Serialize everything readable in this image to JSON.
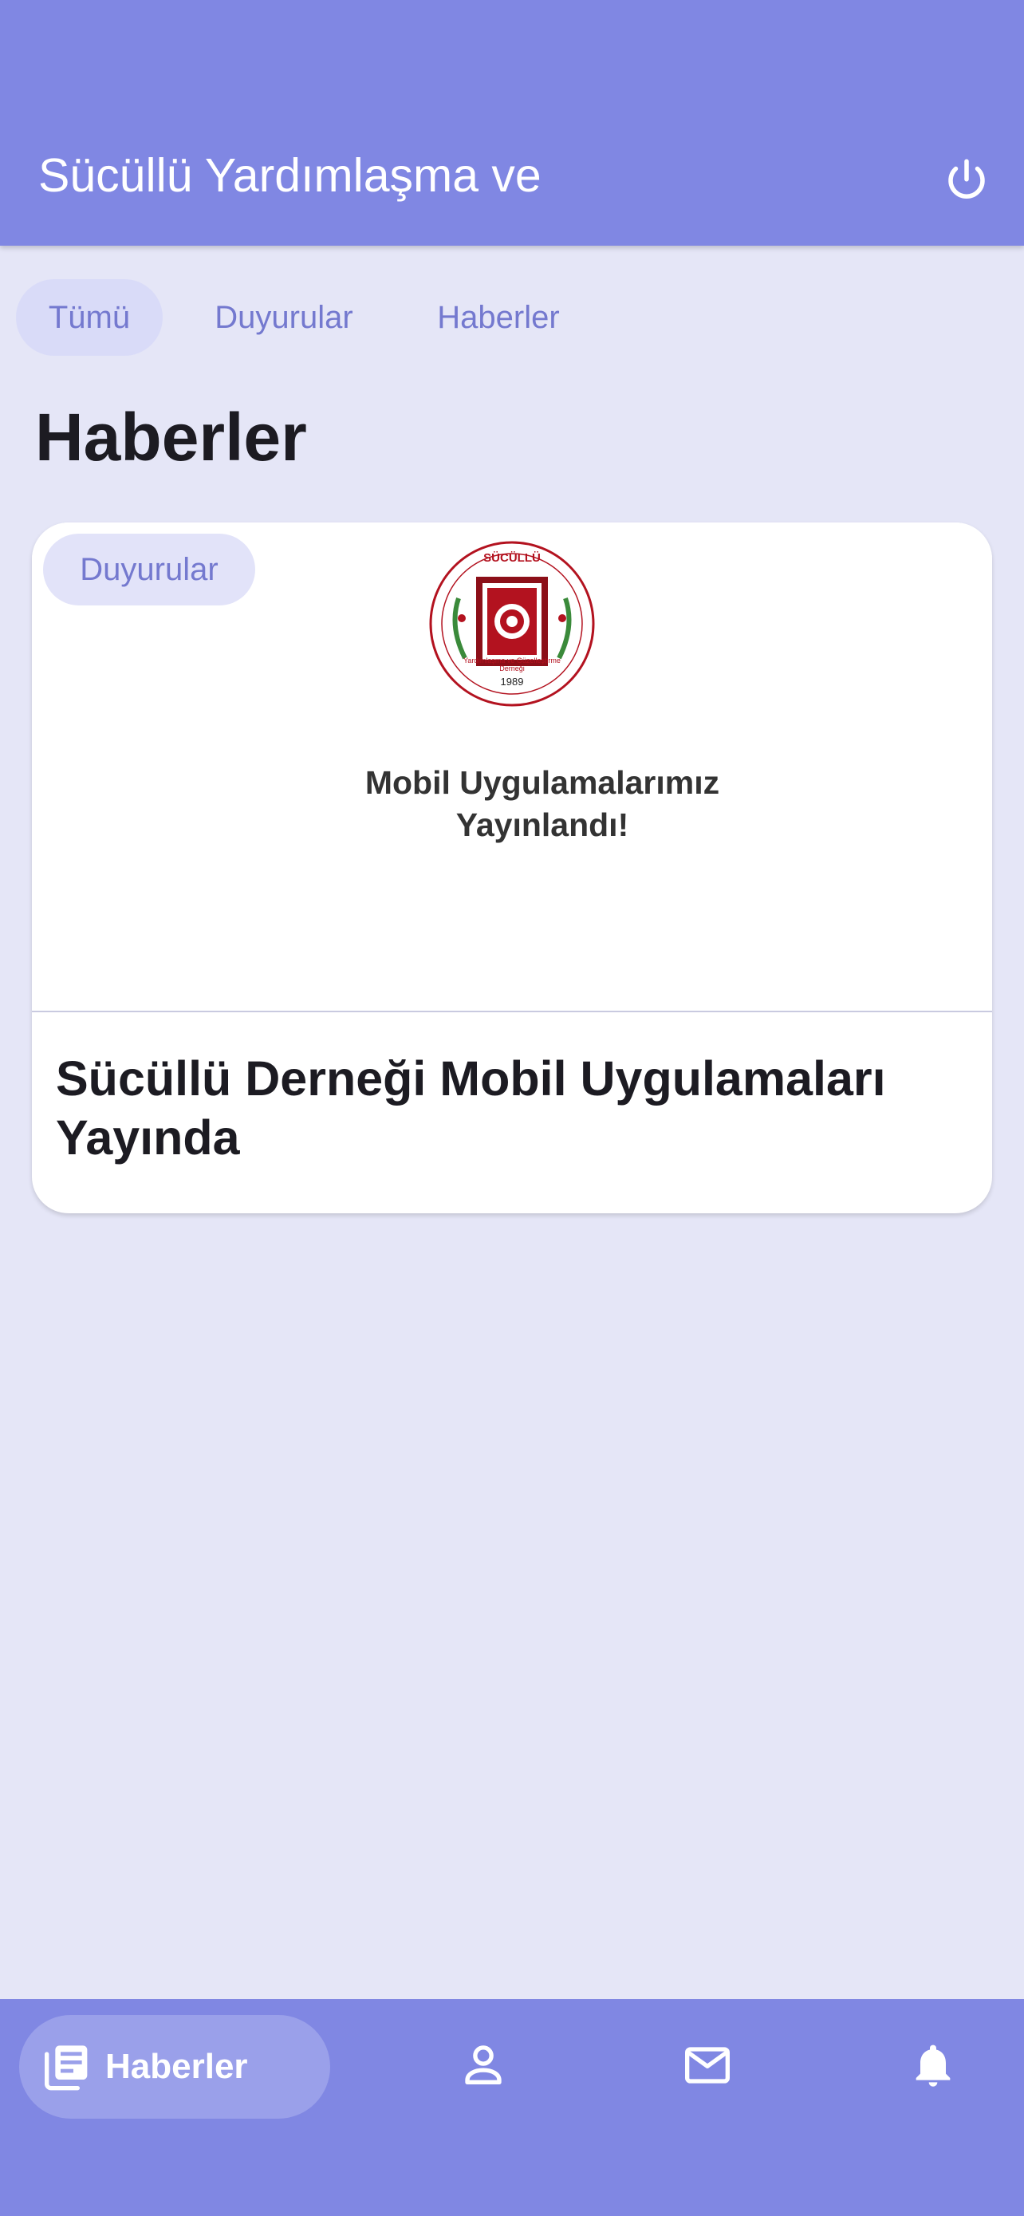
{
  "appbar": {
    "title": "Sücüllü Yardımlaşma ve",
    "power_icon": "power-icon"
  },
  "tabs": [
    {
      "label": "Tümü",
      "active": true
    },
    {
      "label": "Duyurular",
      "active": false
    },
    {
      "label": "Haberler",
      "active": false
    }
  ],
  "page_title": "Haberler",
  "card": {
    "badge": "Duyurular",
    "logo": {
      "top_text": "SÜCÜLLÜ",
      "year": "1989",
      "ring_text": "Yardımlaşma ve Güzelleştirme Derneği"
    },
    "image_caption_line1": "Mobil Uygulamalarımız",
    "image_caption_line2": "Yayınlandı!",
    "title": "Sücüllü Derneği Mobil Uygulamaları Yayında"
  },
  "bottom_nav": {
    "active_label": "Haberler",
    "items": [
      {
        "icon": "newspaper-icon",
        "active": true
      },
      {
        "icon": "person-icon",
        "active": false
      },
      {
        "icon": "mail-icon",
        "active": false
      },
      {
        "icon": "bell-icon",
        "active": false
      }
    ]
  },
  "colors": {
    "primary": "#8087e3",
    "background": "#e5e6f7",
    "chip": "#d9dbf8",
    "accent_text": "#7479cf",
    "logo_red": "#b3121f",
    "logo_green": "#3a8a3a"
  }
}
